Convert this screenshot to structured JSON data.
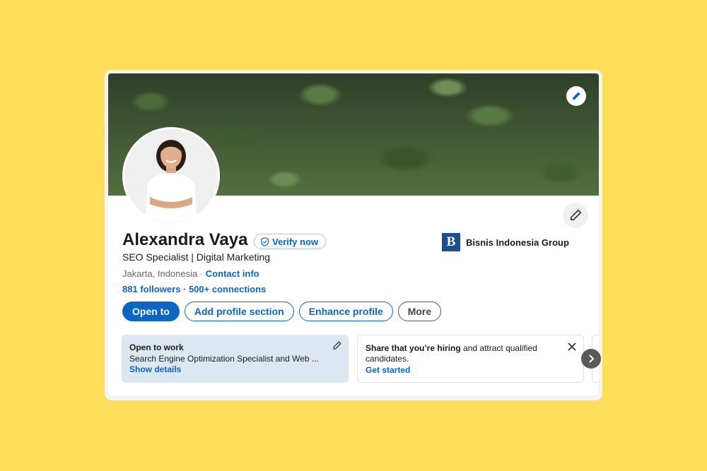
{
  "profile": {
    "name": "Alexandra Vaya",
    "verify_label": "Verify now",
    "headline": "SEO Specialist | Digital Marketing",
    "location": "Jakarta, Indonesia",
    "separator": " · ",
    "contact_info": "Contact info",
    "followers": "881 followers",
    "connections": "500+ connections"
  },
  "company": {
    "logo_letter": "B",
    "name": "Bisnis Indonesia Group"
  },
  "actions": {
    "open_to": "Open to",
    "add_profile_section": "Add profile section",
    "enhance_profile": "Enhance profile",
    "more": "More"
  },
  "open_to_work": {
    "title": "Open to work",
    "description": "Search Engine Optimization Specialist and Web ...",
    "link": "Show details"
  },
  "hiring": {
    "title_bold": "Share that you’re hiring",
    "title_rest": " and attract qualified candidates.",
    "link": "Get started"
  },
  "icons": {
    "cover_edit": "pencil-icon",
    "intro_edit": "pencil-icon",
    "verify": "shield-check-icon",
    "dismiss": "close-icon",
    "next": "chevron-right-icon"
  },
  "colors": {
    "background": "#FFDE59",
    "accent": "#0a66c2",
    "open_to_work_tile": "#dde7f2"
  }
}
